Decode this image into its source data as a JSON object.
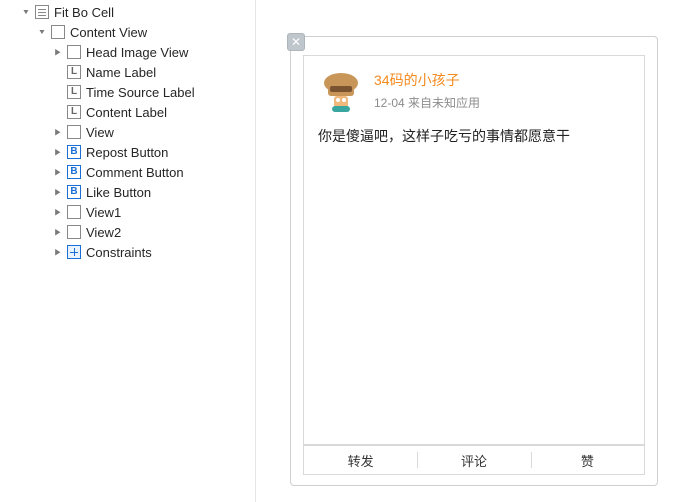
{
  "tree": {
    "root_label": "Fit Bo Cell",
    "content_view_label": "Content View",
    "children": {
      "head_image_view": "Head Image View",
      "name_label": "Name Label",
      "time_source_label": "Time Source Label",
      "content_label": "Content Label",
      "view": "View",
      "repost_button": "Repost Button",
      "comment_button": "Comment Button",
      "like_button": "Like Button",
      "view1": "View1",
      "view2": "View2",
      "constraints": "Constraints"
    }
  },
  "post": {
    "name": "34码的小孩子",
    "time_source": "12-04 来自未知应用",
    "content": "你是傻逼吧，这样子吃亏的事情都愿意干",
    "actions": {
      "repost": "转发",
      "comment": "评论",
      "like": "赞"
    }
  }
}
